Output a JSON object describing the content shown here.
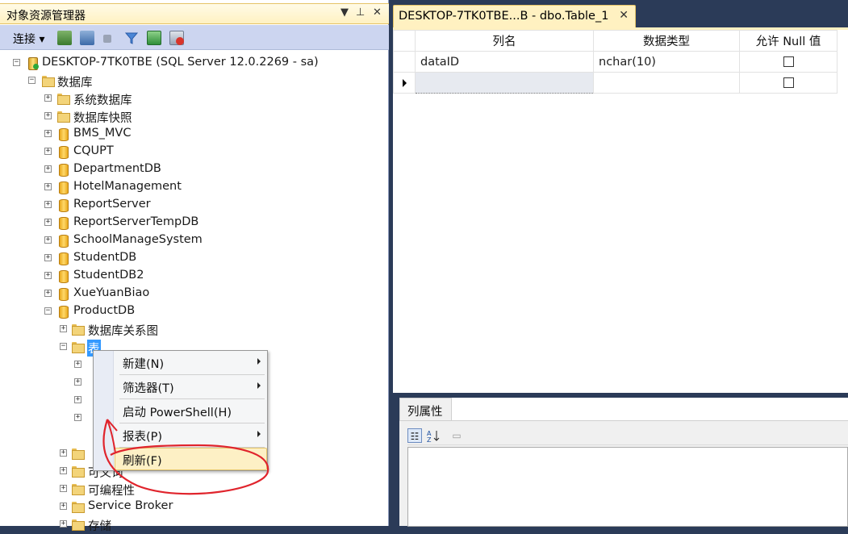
{
  "explorer": {
    "title": "对象资源管理器",
    "pin_glyph": "▼ ꟷ",
    "close_glyph": "✕",
    "toolbar": {
      "connect_label": "连接 ▾"
    }
  },
  "tree": {
    "server": "DESKTOP-7TK0TBE (SQL Server 12.0.2269 - sa)",
    "databases_folder": "数据库",
    "items": [
      {
        "label": "系统数据库",
        "icon": "folder-icon"
      },
      {
        "label": "数据库快照",
        "icon": "folder-icon"
      },
      {
        "label": "BMS_MVC",
        "icon": "database-icon"
      },
      {
        "label": "CQUPT",
        "icon": "database-icon"
      },
      {
        "label": "DepartmentDB",
        "icon": "database-icon"
      },
      {
        "label": "HotelManagement",
        "icon": "database-icon"
      },
      {
        "label": "ReportServer",
        "icon": "database-icon"
      },
      {
        "label": "ReportServerTempDB",
        "icon": "database-icon"
      },
      {
        "label": "SchoolManageSystem",
        "icon": "database-icon"
      },
      {
        "label": "StudentDB",
        "icon": "database-icon"
      },
      {
        "label": "StudentDB2",
        "icon": "database-icon"
      },
      {
        "label": "XueYuanBiao",
        "icon": "database-icon"
      },
      {
        "label": "ProductDB",
        "icon": "database-icon"
      }
    ],
    "productdb_children": {
      "diagrams": "数据库关系图",
      "tables": "表",
      "synonyms_partial": "可义词",
      "programmability": "可编程性",
      "service_broker": "Service Broker",
      "storage": "存储"
    }
  },
  "context_menu": {
    "items": [
      {
        "label": "新建(N)",
        "submenu": true
      },
      {
        "label": "筛选器(T)",
        "submenu": true
      },
      {
        "label": "启动 PowerShell(H)",
        "submenu": false
      },
      {
        "label": "报表(P)",
        "submenu": true
      },
      {
        "label": "刷新(F)",
        "submenu": false,
        "highlighted": true
      }
    ]
  },
  "document": {
    "tab_title": "DESKTOP-7TK0TBE...B - dbo.Table_1",
    "tab_close": "✕",
    "columns": [
      "列名",
      "数据类型",
      "允许 Null 值"
    ],
    "rows": [
      {
        "name": "dataID",
        "type": "nchar(10)",
        "allow_null": false
      },
      {
        "name": "",
        "type": "",
        "allow_null": false
      }
    ]
  },
  "properties": {
    "tab_label": "列属性"
  },
  "annotation_color": "#e0242c"
}
